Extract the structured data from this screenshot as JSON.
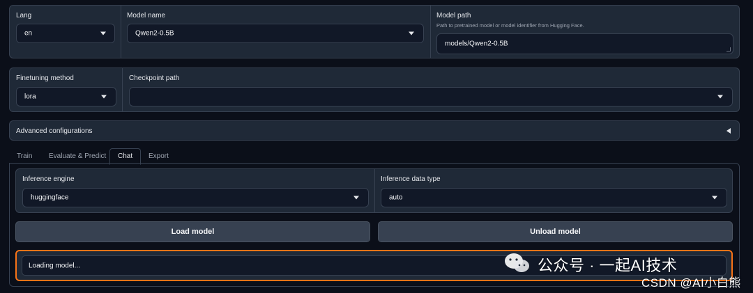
{
  "top": {
    "lang": {
      "label": "Lang",
      "value": "en"
    },
    "model_name": {
      "label": "Model name",
      "value": "Qwen2-0.5B"
    },
    "model_path": {
      "label": "Model path",
      "hint": "Path to pretrained model or model identifier from Hugging Face.",
      "value": "models/Qwen2-0.5B"
    }
  },
  "second": {
    "finetuning": {
      "label": "Finetuning method",
      "value": "lora"
    },
    "checkpoint": {
      "label": "Checkpoint path",
      "value": ""
    }
  },
  "advanced": {
    "label": "Advanced configurations"
  },
  "tabs": [
    {
      "label": "Train"
    },
    {
      "label": "Evaluate & Predict"
    },
    {
      "label": "Chat"
    },
    {
      "label": "Export"
    }
  ],
  "chat": {
    "engine": {
      "label": "Inference engine",
      "value": "huggingface"
    },
    "dtype": {
      "label": "Inference data type",
      "value": "auto"
    },
    "load_btn": "Load model",
    "unload_btn": "Unload model",
    "status": "Loading model..."
  },
  "watermark": {
    "line1": "公众号 · 一起AI技术",
    "line2": "CSDN @AI小白熊"
  },
  "colors": {
    "background": "#0b0f19",
    "panel": "#1f2937",
    "input": "#111827",
    "accent_border": "#f97316"
  }
}
